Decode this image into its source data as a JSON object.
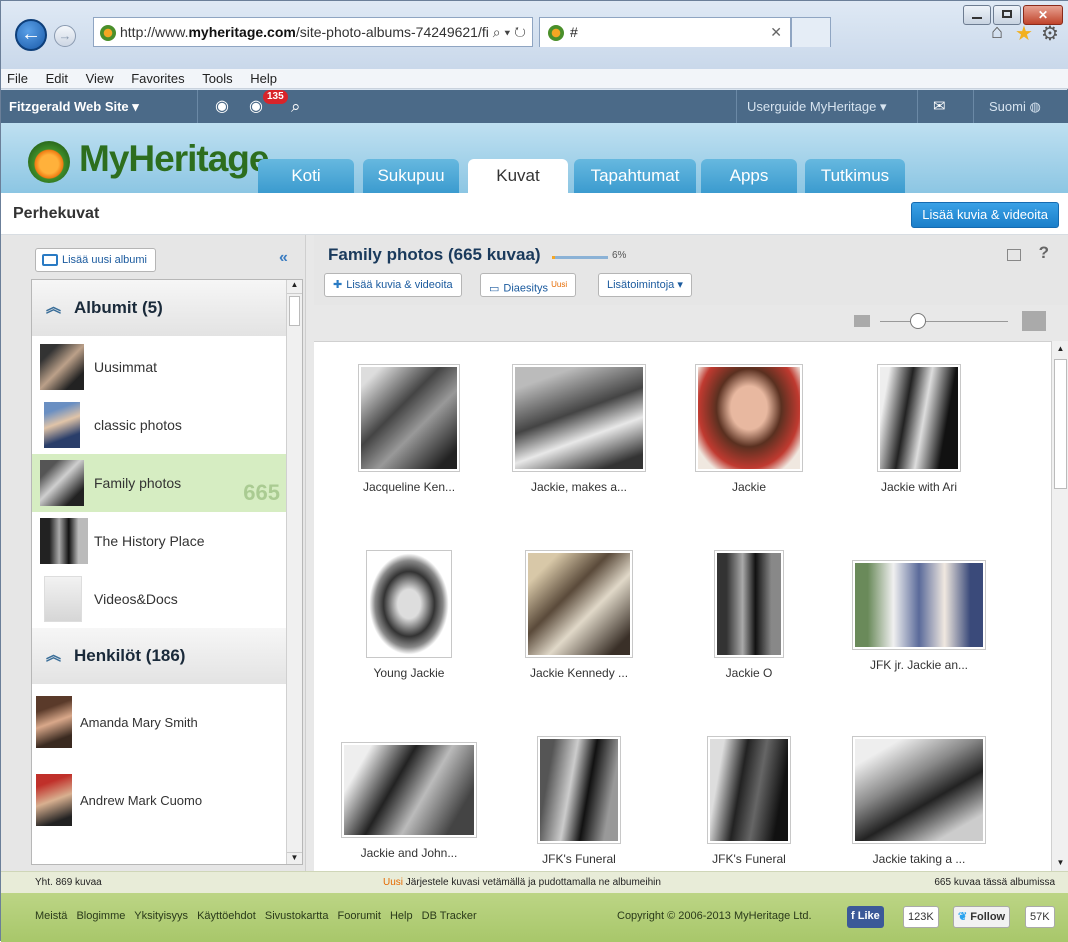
{
  "browser": {
    "url_prefix": "http://www.",
    "url_domain": "myheritage.com",
    "url_path": "/site-photo-albums-74249621/fit",
    "tab_title": "#",
    "menu": [
      "File",
      "Edit",
      "View",
      "Favorites",
      "Tools",
      "Help"
    ]
  },
  "sitebar": {
    "site_name": "Fitzgerald Web Site",
    "badge_count": "135",
    "userguide": "Userguide MyHeritage",
    "language": "Suomi"
  },
  "header": {
    "logo_text": "MyHeritage",
    "tabs": [
      "Koti",
      "Sukupuu",
      "Kuvat",
      "Tapahtumat",
      "Apps",
      "Tutkimus"
    ]
  },
  "titlebar": {
    "title": "Perhekuvat",
    "add_button": "Lisää kuvia & videoita"
  },
  "left": {
    "new_album": "Lisää uusi albumi",
    "albums_header": "Albumit (5)",
    "albums": [
      {
        "name": "Uusimmat"
      },
      {
        "name": "classic photos"
      },
      {
        "name": "Family photos",
        "count": "665"
      },
      {
        "name": "The History Place"
      },
      {
        "name": "Videos&Docs"
      }
    ],
    "people_header": "Henkilöt (186)",
    "people": [
      {
        "name": "Amanda Mary Smith"
      },
      {
        "name": "Andrew Mark Cuomo"
      }
    ]
  },
  "right": {
    "album_title": "Family photos (665 kuvaa)",
    "progress_percent": 6,
    "progress_text": "6%",
    "add_media": "Lisää kuvia & videoita",
    "slideshow": "Diaesitys",
    "slideshow_badge": "Uusi",
    "more_actions": "Lisätoimintoja",
    "help": "?",
    "photos": [
      {
        "caption": "Jacqueline Ken..."
      },
      {
        "caption": "Jackie, makes a..."
      },
      {
        "caption": "Jackie"
      },
      {
        "caption": "Jackie with Ari"
      },
      {
        "caption": "Young Jackie"
      },
      {
        "caption": "Jackie Kennedy ..."
      },
      {
        "caption": "Jackie O"
      },
      {
        "caption": "JFK jr. Jackie an..."
      },
      {
        "caption": "Jackie and John..."
      },
      {
        "caption": "JFK's Funeral"
      },
      {
        "caption": "JFK's Funeral"
      },
      {
        "caption": "Jackie taking a ..."
      }
    ]
  },
  "status": {
    "total": "Yht. 869 kuvaa",
    "tip_new": "Uusi",
    "tip_text": "Järjestele kuvasi vetämällä ja pudottamalla ne albumeihin",
    "in_album": "665 kuvaa tässä albumissa"
  },
  "footer": {
    "links": [
      "Meistä",
      "Blogimme",
      "Yksityisyys",
      "Käyttöehdot",
      "Sivustokartta",
      "Foorumit",
      "Help",
      "DB Tracker"
    ],
    "copyright": "Copyright © 2006-2013 MyHeritage Ltd.",
    "like": "Like",
    "like_count": "123K",
    "follow": "Follow",
    "follow_count": "57K"
  }
}
